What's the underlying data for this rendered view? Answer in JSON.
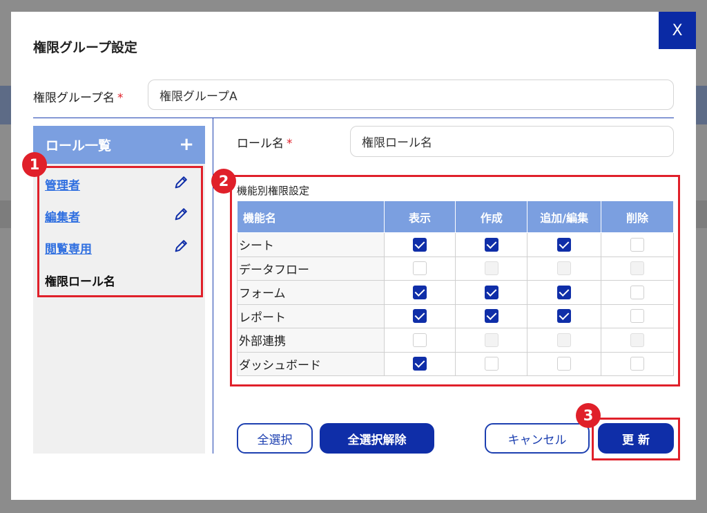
{
  "dialog": {
    "title": "権限グループ設定",
    "close_label": "X"
  },
  "group_name": {
    "label": "権限グループ名",
    "required_mark": "*",
    "value": "権限グループA"
  },
  "role_list": {
    "header": "ロール一覧",
    "add_label": "+",
    "items": [
      {
        "label": "管理者",
        "link": true
      },
      {
        "label": "編集者",
        "link": true
      },
      {
        "label": "閲覧専用",
        "link": true
      },
      {
        "label": "権限ロール名",
        "link": false
      }
    ]
  },
  "role_name": {
    "label": "ロール名",
    "required_mark": "*",
    "value": "権限ロール名"
  },
  "permissions": {
    "section_label": "機能別権限設定",
    "columns": [
      "機能名",
      "表示",
      "作成",
      "追加/編集",
      "削除"
    ],
    "rows": [
      {
        "name": "シート",
        "checks": [
          "on",
          "on",
          "on",
          "off"
        ]
      },
      {
        "name": "データフロー",
        "checks": [
          "off",
          "dis",
          "dis",
          "dis"
        ]
      },
      {
        "name": "フォーム",
        "checks": [
          "on",
          "on",
          "on",
          "off"
        ]
      },
      {
        "name": "レポート",
        "checks": [
          "on",
          "on",
          "on",
          "off"
        ]
      },
      {
        "name": "外部連携",
        "checks": [
          "off",
          "dis",
          "dis",
          "dis"
        ]
      },
      {
        "name": "ダッシュボード",
        "checks": [
          "on",
          "off",
          "off",
          "off"
        ]
      }
    ]
  },
  "buttons": {
    "select_all": "全選択",
    "deselect_all": "全選択解除",
    "cancel": "キャンセル",
    "update": "更 新"
  },
  "annotations": {
    "badge1": "1",
    "badge2": "2",
    "badge3": "3",
    "color": "#e0202a"
  },
  "colors": {
    "accent": "#0f2ea8",
    "header_blue": "#7b9fe0",
    "link": "#2f6fe0"
  }
}
